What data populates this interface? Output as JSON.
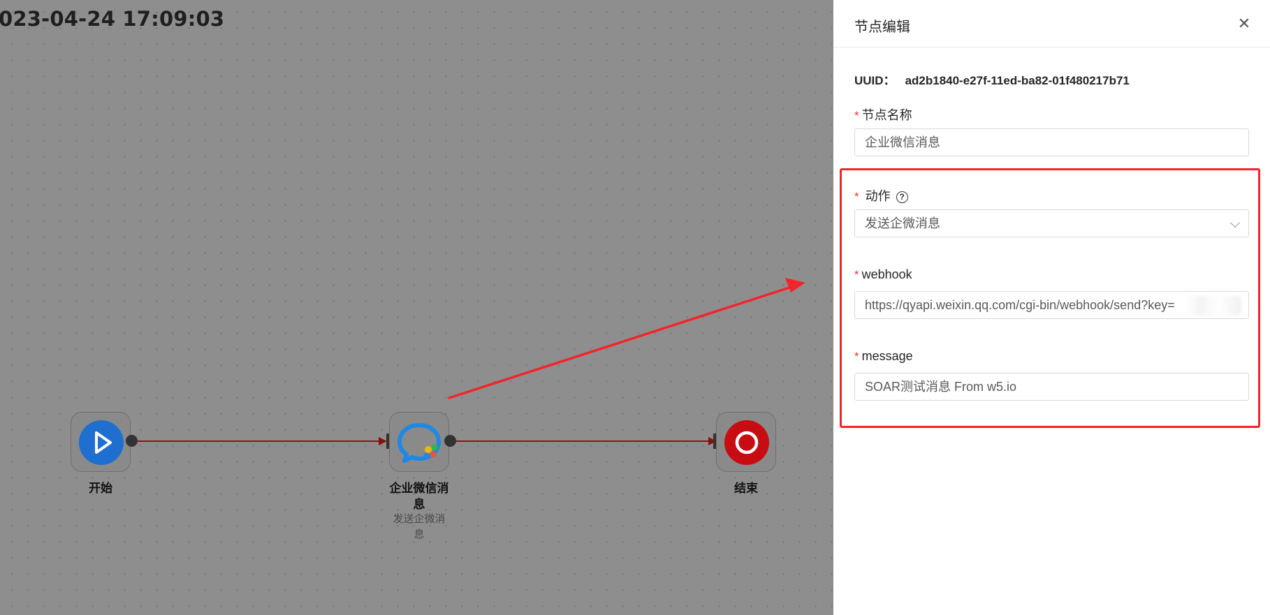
{
  "canvas": {
    "timestamp": "023-04-24 17:09:03",
    "nodes": [
      {
        "label": "开始",
        "subtitle": ""
      },
      {
        "label": "企业微信消息",
        "label_line1": "企业微信消",
        "label_line2": "息",
        "subtitle_line1": "发送企微消",
        "subtitle_line2": "息"
      },
      {
        "label": "结束",
        "subtitle": ""
      }
    ]
  },
  "drawer": {
    "title": "节点编辑",
    "close_icon": "close-icon",
    "uuid_label": "UUID：",
    "uuid_value": "ad2b1840-e27f-11ed-ba82-01f480217b71",
    "fields": {
      "name": {
        "label": "节点名称",
        "value": "企业微信消息"
      },
      "action": {
        "label": "动作",
        "value": "发送企微消息"
      },
      "webhook": {
        "label": "webhook",
        "value": "https://qyapi.weixin.qq.com/cgi-bin/webhook/send?key="
      },
      "message": {
        "label": "message",
        "value": "SOAR测试消息 From w5.io"
      }
    },
    "required_mark": "*"
  },
  "colors": {
    "annotation": "#f5232a",
    "edge": "#7f1a1a",
    "start_node": "#1f6fd1",
    "end_node": "#c80d12"
  }
}
